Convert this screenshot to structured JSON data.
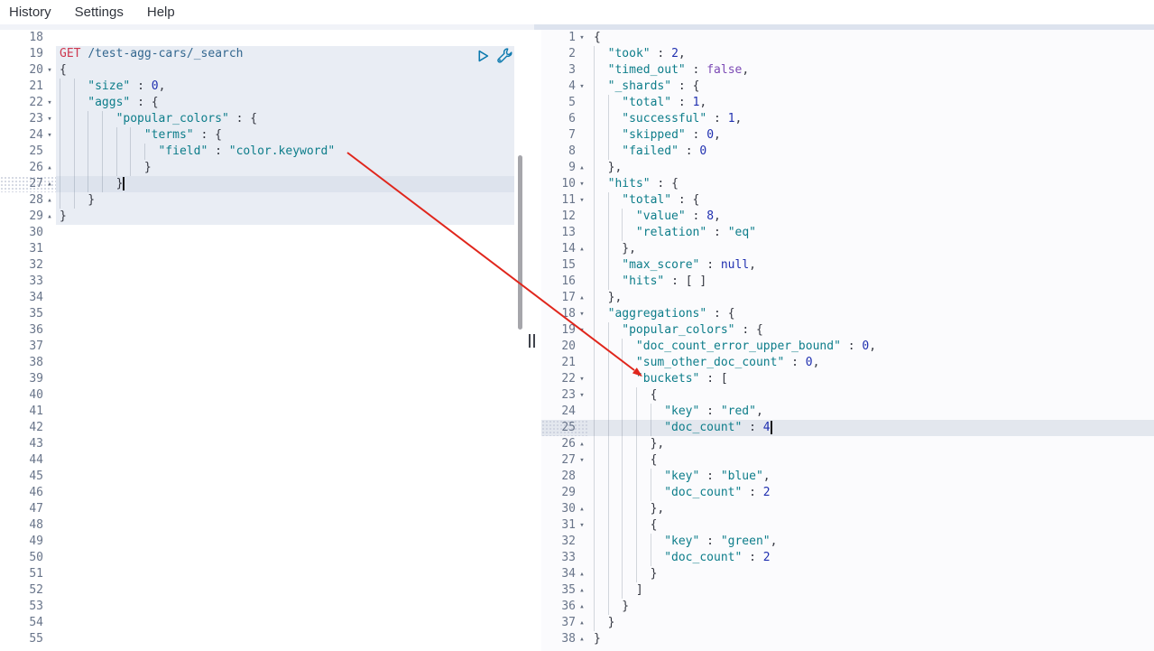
{
  "menu": {
    "items": [
      {
        "name": "history",
        "label": "History"
      },
      {
        "name": "settings",
        "label": "Settings"
      },
      {
        "name": "help",
        "label": "Help"
      }
    ]
  },
  "icons": {
    "send": "play-icon",
    "options": "wrench-icon",
    "split": "grip-icon"
  },
  "colors": {
    "method": "#ce384f",
    "url": "#33678f",
    "string": "#0d7d8a",
    "number": "#2030b0",
    "boolean": "#7c4ab5",
    "arrow": "#e0261c",
    "icon_blue": "#0b79ae",
    "request_block_bg": "#e9edf4",
    "active_line_bg": "#dde3ed"
  },
  "annotation_arrow": {
    "color": "#e0261c",
    "from_text": "\"color.keyword\"",
    "to_text": "\"buckets\""
  },
  "request_editor": {
    "lines": [
      {
        "n": 18,
        "g": 0,
        "s": []
      },
      {
        "n": 19,
        "g": 0,
        "hl": true,
        "s": [
          {
            "c": "m",
            "t": "GET "
          },
          {
            "c": "u",
            "t": "/test-agg-cars/_search"
          }
        ]
      },
      {
        "n": 20,
        "f": "d",
        "g": 0,
        "hl": true,
        "s": [
          {
            "c": "p",
            "t": "{"
          }
        ]
      },
      {
        "n": 21,
        "g": 2,
        "hl": true,
        "s": [
          {
            "c": "k",
            "t": "\"size\""
          },
          {
            "c": "p",
            "t": " : "
          },
          {
            "c": "n",
            "t": "0"
          },
          {
            "c": "p",
            "t": ","
          }
        ]
      },
      {
        "n": 22,
        "f": "d",
        "g": 2,
        "hl": true,
        "s": [
          {
            "c": "k",
            "t": "\"aggs\""
          },
          {
            "c": "p",
            "t": " : {"
          }
        ]
      },
      {
        "n": 23,
        "f": "d",
        "g": 4,
        "hl": true,
        "s": [
          {
            "c": "k",
            "t": "\"popular_colors\""
          },
          {
            "c": "p",
            "t": " : {"
          }
        ]
      },
      {
        "n": 24,
        "f": "d",
        "g": 6,
        "hl": true,
        "s": [
          {
            "c": "k",
            "t": "\"terms\""
          },
          {
            "c": "p",
            "t": " : {"
          }
        ]
      },
      {
        "n": 25,
        "g": 7,
        "hl": true,
        "s": [
          {
            "c": "k",
            "t": "\"field\""
          },
          {
            "c": "p",
            "t": " : "
          },
          {
            "c": "k",
            "t": "\"color.keyword\""
          }
        ]
      },
      {
        "n": 26,
        "f": "u",
        "g": 6,
        "hl": true,
        "s": [
          {
            "c": "p",
            "t": "}"
          }
        ]
      },
      {
        "n": 27,
        "f": "u",
        "g": 4,
        "hl": true,
        "active": true,
        "cursor": true,
        "s": [
          {
            "c": "p",
            "t": "}"
          }
        ]
      },
      {
        "n": 28,
        "f": "u",
        "g": 2,
        "hl": true,
        "s": [
          {
            "c": "p",
            "t": "}"
          }
        ]
      },
      {
        "n": 29,
        "f": "u",
        "g": 0,
        "hl": true,
        "s": [
          {
            "c": "p",
            "t": "}"
          }
        ]
      },
      {
        "n": 30,
        "g": 0,
        "s": []
      },
      {
        "n": 31,
        "g": 0,
        "s": []
      },
      {
        "n": 32,
        "g": 0,
        "s": []
      },
      {
        "n": 33,
        "g": 0,
        "s": []
      },
      {
        "n": 34,
        "g": 0,
        "s": []
      },
      {
        "n": 35,
        "g": 0,
        "s": []
      },
      {
        "n": 36,
        "g": 0,
        "s": []
      },
      {
        "n": 37,
        "g": 0,
        "s": []
      },
      {
        "n": 38,
        "g": 0,
        "s": []
      },
      {
        "n": 39,
        "g": 0,
        "s": []
      },
      {
        "n": 40,
        "g": 0,
        "s": []
      },
      {
        "n": 41,
        "g": 0,
        "s": []
      },
      {
        "n": 42,
        "g": 0,
        "s": []
      },
      {
        "n": 43,
        "g": 0,
        "s": []
      },
      {
        "n": 44,
        "g": 0,
        "s": []
      },
      {
        "n": 45,
        "g": 0,
        "s": []
      },
      {
        "n": 46,
        "g": 0,
        "s": []
      },
      {
        "n": 47,
        "g": 0,
        "s": []
      },
      {
        "n": 48,
        "g": 0,
        "s": []
      },
      {
        "n": 49,
        "g": 0,
        "s": []
      },
      {
        "n": 50,
        "g": 0,
        "s": []
      },
      {
        "n": 51,
        "g": 0,
        "s": []
      },
      {
        "n": 52,
        "g": 0,
        "s": []
      },
      {
        "n": 53,
        "g": 0,
        "s": []
      },
      {
        "n": 54,
        "g": 0,
        "s": []
      },
      {
        "n": 55,
        "g": 0,
        "s": []
      }
    ]
  },
  "response_editor": {
    "lines": [
      {
        "n": 1,
        "f": "d",
        "g": 0,
        "s": [
          {
            "c": "p",
            "t": "{"
          }
        ]
      },
      {
        "n": 2,
        "g": 1,
        "s": [
          {
            "c": "k",
            "t": "\"took\""
          },
          {
            "c": "p",
            "t": " : "
          },
          {
            "c": "n",
            "t": "2"
          },
          {
            "c": "p",
            "t": ","
          }
        ]
      },
      {
        "n": 3,
        "g": 1,
        "s": [
          {
            "c": "k",
            "t": "\"timed_out\""
          },
          {
            "c": "p",
            "t": " : "
          },
          {
            "c": "b",
            "t": "false"
          },
          {
            "c": "p",
            "t": ","
          }
        ]
      },
      {
        "n": 4,
        "f": "d",
        "g": 1,
        "s": [
          {
            "c": "k",
            "t": "\"_shards\""
          },
          {
            "c": "p",
            "t": " : {"
          }
        ]
      },
      {
        "n": 5,
        "g": 2,
        "s": [
          {
            "c": "k",
            "t": "\"total\""
          },
          {
            "c": "p",
            "t": " : "
          },
          {
            "c": "n",
            "t": "1"
          },
          {
            "c": "p",
            "t": ","
          }
        ]
      },
      {
        "n": 6,
        "g": 2,
        "s": [
          {
            "c": "k",
            "t": "\"successful\""
          },
          {
            "c": "p",
            "t": " : "
          },
          {
            "c": "n",
            "t": "1"
          },
          {
            "c": "p",
            "t": ","
          }
        ]
      },
      {
        "n": 7,
        "g": 2,
        "s": [
          {
            "c": "k",
            "t": "\"skipped\""
          },
          {
            "c": "p",
            "t": " : "
          },
          {
            "c": "n",
            "t": "0"
          },
          {
            "c": "p",
            "t": ","
          }
        ]
      },
      {
        "n": 8,
        "g": 2,
        "s": [
          {
            "c": "k",
            "t": "\"failed\""
          },
          {
            "c": "p",
            "t": " : "
          },
          {
            "c": "n",
            "t": "0"
          }
        ]
      },
      {
        "n": 9,
        "f": "u",
        "g": 1,
        "s": [
          {
            "c": "p",
            "t": "},"
          }
        ]
      },
      {
        "n": 10,
        "f": "d",
        "g": 1,
        "s": [
          {
            "c": "k",
            "t": "\"hits\""
          },
          {
            "c": "p",
            "t": " : {"
          }
        ]
      },
      {
        "n": 11,
        "f": "d",
        "g": 2,
        "s": [
          {
            "c": "k",
            "t": "\"total\""
          },
          {
            "c": "p",
            "t": " : {"
          }
        ]
      },
      {
        "n": 12,
        "g": 3,
        "s": [
          {
            "c": "k",
            "t": "\"value\""
          },
          {
            "c": "p",
            "t": " : "
          },
          {
            "c": "n",
            "t": "8"
          },
          {
            "c": "p",
            "t": ","
          }
        ]
      },
      {
        "n": 13,
        "g": 3,
        "s": [
          {
            "c": "k",
            "t": "\"relation\""
          },
          {
            "c": "p",
            "t": " : "
          },
          {
            "c": "k",
            "t": "\"eq\""
          }
        ]
      },
      {
        "n": 14,
        "f": "u",
        "g": 2,
        "s": [
          {
            "c": "p",
            "t": "},"
          }
        ]
      },
      {
        "n": 15,
        "g": 2,
        "s": [
          {
            "c": "k",
            "t": "\"max_score\""
          },
          {
            "c": "p",
            "t": " : "
          },
          {
            "c": "n",
            "t": "null"
          },
          {
            "c": "p",
            "t": ","
          }
        ]
      },
      {
        "n": 16,
        "g": 2,
        "s": [
          {
            "c": "k",
            "t": "\"hits\""
          },
          {
            "c": "p",
            "t": " : [ ]"
          }
        ]
      },
      {
        "n": 17,
        "f": "u",
        "g": 1,
        "s": [
          {
            "c": "p",
            "t": "},"
          }
        ]
      },
      {
        "n": 18,
        "f": "d",
        "g": 1,
        "s": [
          {
            "c": "k",
            "t": "\"aggregations\""
          },
          {
            "c": "p",
            "t": " : {"
          }
        ]
      },
      {
        "n": 19,
        "f": "d",
        "g": 2,
        "s": [
          {
            "c": "k",
            "t": "\"popular_colors\""
          },
          {
            "c": "p",
            "t": " : {"
          }
        ]
      },
      {
        "n": 20,
        "g": 3,
        "s": [
          {
            "c": "k",
            "t": "\"doc_count_error_upper_bound\""
          },
          {
            "c": "p",
            "t": " : "
          },
          {
            "c": "n",
            "t": "0"
          },
          {
            "c": "p",
            "t": ","
          }
        ]
      },
      {
        "n": 21,
        "g": 3,
        "s": [
          {
            "c": "k",
            "t": "\"sum_other_doc_count\""
          },
          {
            "c": "p",
            "t": " : "
          },
          {
            "c": "n",
            "t": "0"
          },
          {
            "c": "p",
            "t": ","
          }
        ]
      },
      {
        "n": 22,
        "f": "d",
        "g": 3,
        "s": [
          {
            "c": "k",
            "t": "\"buckets\""
          },
          {
            "c": "p",
            "t": " : ["
          }
        ]
      },
      {
        "n": 23,
        "f": "d",
        "g": 4,
        "s": [
          {
            "c": "p",
            "t": "{"
          }
        ]
      },
      {
        "n": 24,
        "g": 5,
        "s": [
          {
            "c": "k",
            "t": "\"key\""
          },
          {
            "c": "p",
            "t": " : "
          },
          {
            "c": "k",
            "t": "\"red\""
          },
          {
            "c": "p",
            "t": ","
          }
        ]
      },
      {
        "n": 25,
        "g": 5,
        "active": true,
        "cursor": true,
        "s": [
          {
            "c": "k",
            "t": "\"doc_count\""
          },
          {
            "c": "p",
            "t": " : "
          },
          {
            "c": "n",
            "t": "4"
          }
        ]
      },
      {
        "n": 26,
        "f": "u",
        "g": 4,
        "s": [
          {
            "c": "p",
            "t": "},"
          }
        ]
      },
      {
        "n": 27,
        "f": "d",
        "g": 4,
        "s": [
          {
            "c": "p",
            "t": "{"
          }
        ]
      },
      {
        "n": 28,
        "g": 5,
        "s": [
          {
            "c": "k",
            "t": "\"key\""
          },
          {
            "c": "p",
            "t": " : "
          },
          {
            "c": "k",
            "t": "\"blue\""
          },
          {
            "c": "p",
            "t": ","
          }
        ]
      },
      {
        "n": 29,
        "g": 5,
        "s": [
          {
            "c": "k",
            "t": "\"doc_count\""
          },
          {
            "c": "p",
            "t": " : "
          },
          {
            "c": "n",
            "t": "2"
          }
        ]
      },
      {
        "n": 30,
        "f": "u",
        "g": 4,
        "s": [
          {
            "c": "p",
            "t": "},"
          }
        ]
      },
      {
        "n": 31,
        "f": "d",
        "g": 4,
        "s": [
          {
            "c": "p",
            "t": "{"
          }
        ]
      },
      {
        "n": 32,
        "g": 5,
        "s": [
          {
            "c": "k",
            "t": "\"key\""
          },
          {
            "c": "p",
            "t": " : "
          },
          {
            "c": "k",
            "t": "\"green\""
          },
          {
            "c": "p",
            "t": ","
          }
        ]
      },
      {
        "n": 33,
        "g": 5,
        "s": [
          {
            "c": "k",
            "t": "\"doc_count\""
          },
          {
            "c": "p",
            "t": " : "
          },
          {
            "c": "n",
            "t": "2"
          }
        ]
      },
      {
        "n": 34,
        "f": "u",
        "g": 4,
        "s": [
          {
            "c": "p",
            "t": "}"
          }
        ]
      },
      {
        "n": 35,
        "f": "u",
        "g": 3,
        "s": [
          {
            "c": "p",
            "t": "]"
          }
        ]
      },
      {
        "n": 36,
        "f": "u",
        "g": 2,
        "s": [
          {
            "c": "p",
            "t": "}"
          }
        ]
      },
      {
        "n": 37,
        "f": "u",
        "g": 1,
        "s": [
          {
            "c": "p",
            "t": "}"
          }
        ]
      },
      {
        "n": 38,
        "f": "u",
        "g": 0,
        "s": [
          {
            "c": "p",
            "t": "}"
          }
        ]
      }
    ]
  }
}
